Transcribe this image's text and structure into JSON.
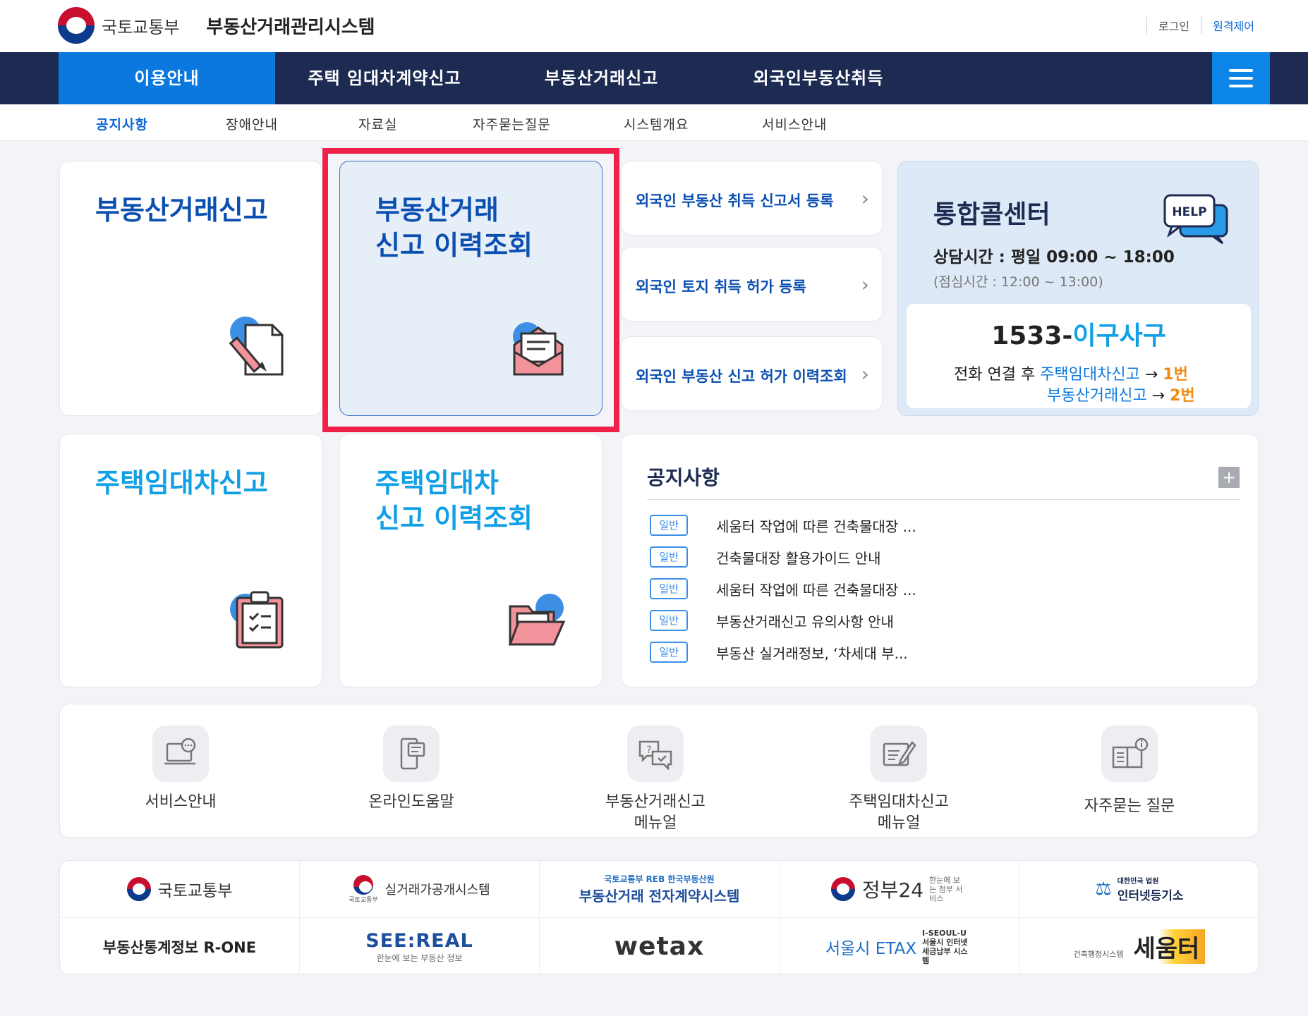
{
  "header": {
    "ministry": "국토교통부",
    "system_name": "부동산거래관리시스템",
    "login": "로그인",
    "remote": "원격제어"
  },
  "gnb": {
    "items": [
      {
        "label": "이용안내"
      },
      {
        "label": "주택 임대차계약신고"
      },
      {
        "label": "부동산거래신고"
      },
      {
        "label": "외국인부동산취득"
      }
    ]
  },
  "lnb": {
    "items": [
      {
        "label": "공지사항"
      },
      {
        "label": "장애안내"
      },
      {
        "label": "자료실"
      },
      {
        "label": "자주묻는질문"
      },
      {
        "label": "시스템개요"
      },
      {
        "label": "서비스안내"
      }
    ]
  },
  "cards": {
    "realestate_report": "부동산거래신고",
    "realestate_history_1": "부동산거래",
    "realestate_history_2": "신고 이력조회",
    "lease_report": "주택임대차신고",
    "lease_history_1": "주택임대차",
    "lease_history_2": "신고 이력조회"
  },
  "links": [
    {
      "label": "외국인 부동산 취득 신고서 등록"
    },
    {
      "label": "외국인 토지 취득 허가 등록"
    },
    {
      "label": "외국인 부동산 신고 허가 이력조회"
    }
  ],
  "callcenter": {
    "title": "통합콜센터",
    "help": "HELP",
    "hours": "상담시간 : 평일 09:00 ~ 18:00",
    "lunch": "(점심시간 : 12:00 ~ 13:00)",
    "phone_prefix": "1533-",
    "phone_word": "이구사구",
    "line1_prefix": "전화 연결 후 ",
    "line1_service": "주택임대차신고",
    "line1_arrow": " → ",
    "line1_num": "1번",
    "line2_service": "부동산거래신고",
    "line2_arrow": " → ",
    "line2_num": "2번"
  },
  "notice": {
    "title": "공지사항",
    "plus": "+",
    "items": [
      {
        "badge": "일반",
        "text": "세움터 작업에 따른 건축물대장 ..."
      },
      {
        "badge": "일반",
        "text": "건축물대장 활용가이드 안내"
      },
      {
        "badge": "일반",
        "text": "세움터 작업에 따른 건축물대장 ..."
      },
      {
        "badge": "일반",
        "text": "부동산거래신고 유의사항 안내"
      },
      {
        "badge": "일반",
        "text": "부동산 실거래정보, ‘차세대 부..."
      }
    ]
  },
  "quick": [
    {
      "label": "서비스안내",
      "icon": "laptop-chat-icon"
    },
    {
      "label": "온라인도움말",
      "icon": "mobile-doc-icon"
    },
    {
      "label": "부동산거래신고\n메뉴얼",
      "icon": "qa-bubble-icon"
    },
    {
      "label": "주택임대차신고\n메뉴얼",
      "icon": "edit-doc-icon"
    },
    {
      "label": "자주묻는 질문",
      "icon": "book-info-icon"
    }
  ],
  "sites": {
    "molit": "국토교통부",
    "rtms": "실거래가공개시스템",
    "rtms_sub": "국토교통부",
    "econtract_top": "국토교통부  REB 한국부동산원",
    "econtract": "부동산거래 전자계약시스템",
    "gov24": "정부24",
    "gov24_sub": "한눈에 보는 정부 서비스",
    "iros_top": "대한민국 법원",
    "iros": "인터넷등기소",
    "rone": "부동산통계정보 R-ONE",
    "seereal": "SEE:REAL",
    "seereal_sub": "한눈에 보는 부동산 정보",
    "wetax": "wetax",
    "etax": "서울시 ETAX",
    "etax_sub": "I-SEOUL-U 서울시 인터넷 세금납부 시스템",
    "seumter": "세움터",
    "seumter_sub": "건축행정시스템"
  },
  "colors": {
    "navy": "#1d2b53",
    "accent": "#0b78e0",
    "highlight": "#f0204a",
    "orange": "#f28a12"
  }
}
